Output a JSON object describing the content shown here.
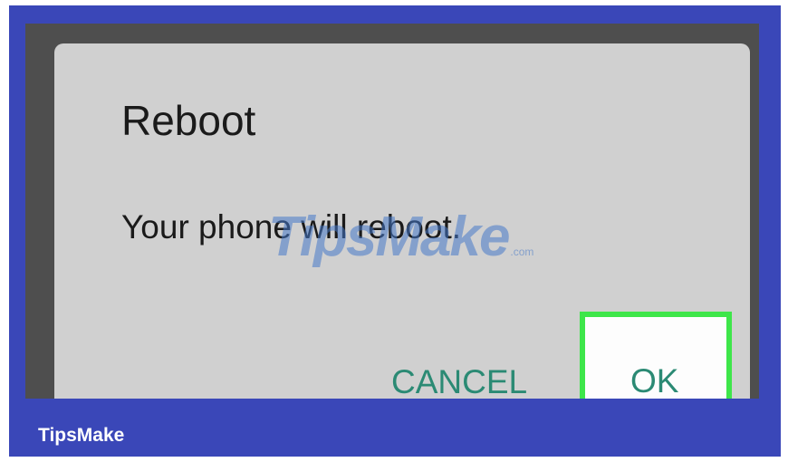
{
  "dialog": {
    "title": "Reboot",
    "message": "Your phone will reboot.",
    "cancel_label": "CANCEL",
    "ok_label": "OK"
  },
  "watermark": {
    "text": "TipsMake",
    "suffix": ".com"
  },
  "footer": {
    "brand": "TipsMake"
  },
  "colors": {
    "frame_blue": "#3a47b8",
    "screen_dark": "#4e4e4e",
    "dialog_bg": "#d0d0d0",
    "button_text": "#2b8a74",
    "highlight_green": "#3ee64a"
  }
}
